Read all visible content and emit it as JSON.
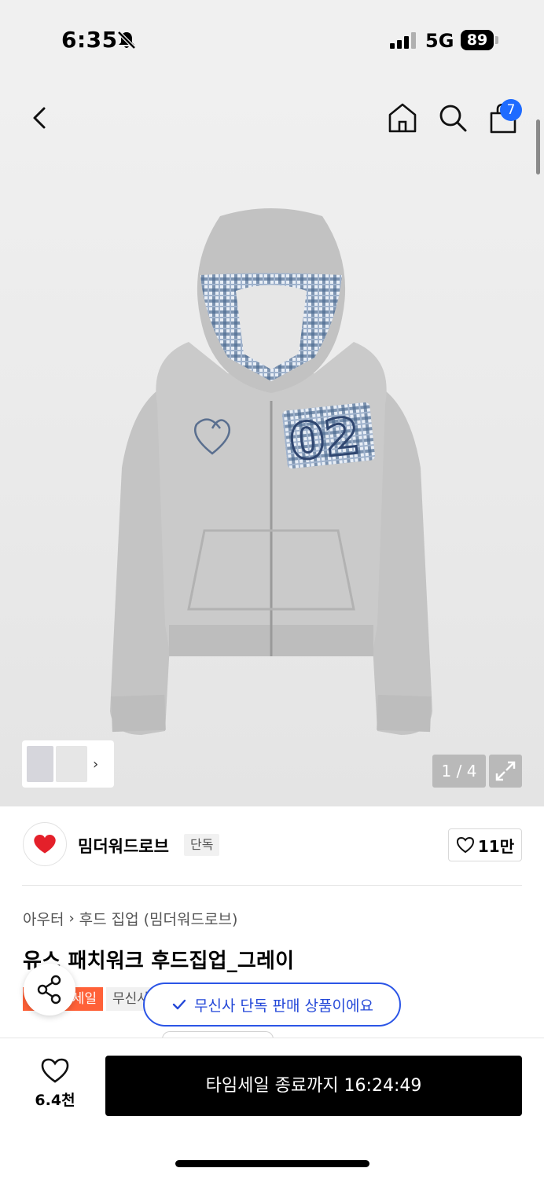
{
  "status_bar": {
    "time": "6:35",
    "network": "5G",
    "battery": "89"
  },
  "header": {
    "cart_count": "7"
  },
  "gallery": {
    "pager": "1 / 4",
    "thumb_arrow": "›",
    "patch_text": "02"
  },
  "brand": {
    "name": "밈더워드로브",
    "tag": "단독",
    "likes": "11만"
  },
  "breadcrumb": {
    "category": "아우터",
    "separator": "›",
    "subcategory": "후드 집업 (밈더워드로브)"
  },
  "product": {
    "title": "유스 패치워크 후드집업_그레이",
    "sale_tag": "세일",
    "mall_tag": "무신사"
  },
  "toast": {
    "text": "무신사 단독 판매 상품이에요"
  },
  "bottom": {
    "wish_count": "6.4천",
    "buy_label": "타임세일 종료까지 16:24:49"
  },
  "colors": {
    "accent": "#1e6bff",
    "sale": "#ff6138",
    "toast": "#2448d8",
    "button": "#000000"
  }
}
